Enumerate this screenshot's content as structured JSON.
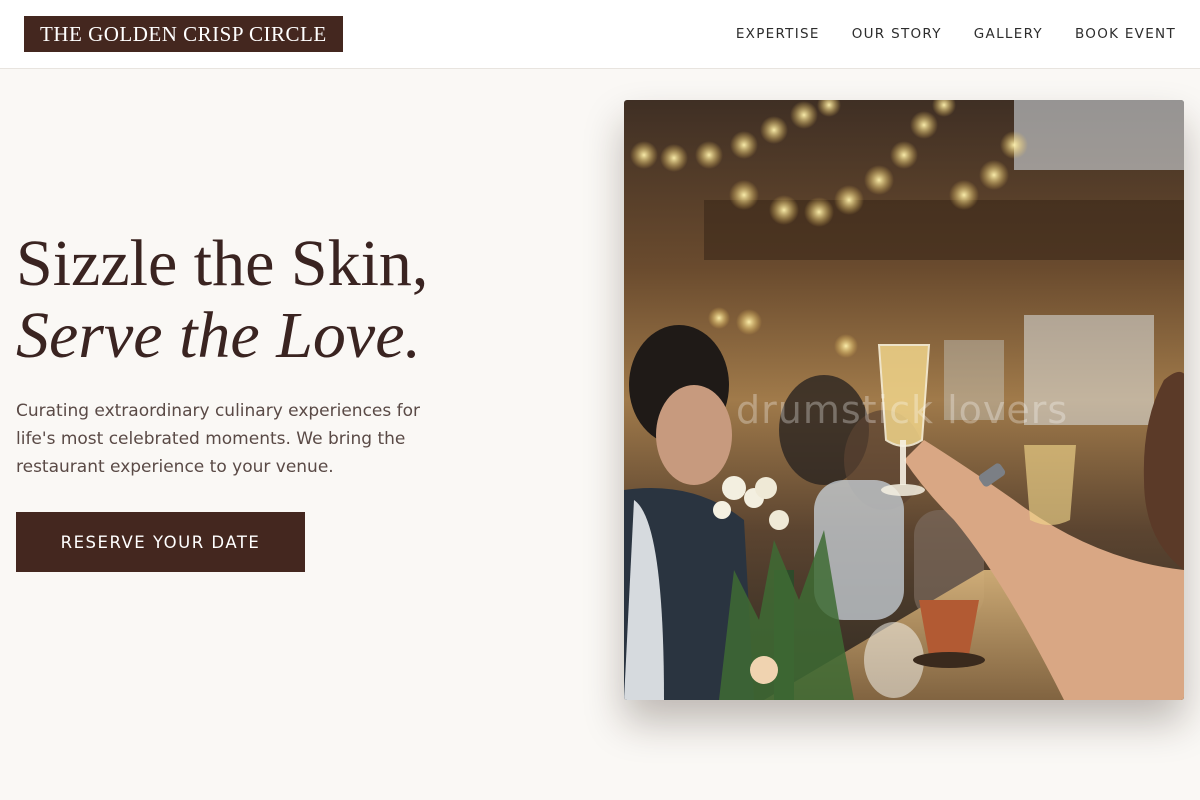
{
  "brand": {
    "name": "THE GOLDEN CRISP CIRCLE"
  },
  "nav": {
    "items": [
      {
        "label": "EXPERTISE"
      },
      {
        "label": "OUR STORY"
      },
      {
        "label": "GALLERY"
      },
      {
        "label": "BOOK EVENT"
      }
    ]
  },
  "hero": {
    "title_line1": "Sizzle the Skin,",
    "title_line2": "Serve the Love.",
    "description": "Curating extraordinary culinary experiences for life's most celebrated moments. We bring the restaurant experience to your venue.",
    "cta_label": "RESERVE YOUR DATE"
  },
  "photo": {
    "alt": "Guests raising champagne glasses at a banquet under string lights",
    "watermark": "drumstick lovers"
  },
  "colors": {
    "brand_dark": "#44271f",
    "page_background": "#faf8f5",
    "heading_text": "#3a2421",
    "body_text": "#5a4a46"
  }
}
